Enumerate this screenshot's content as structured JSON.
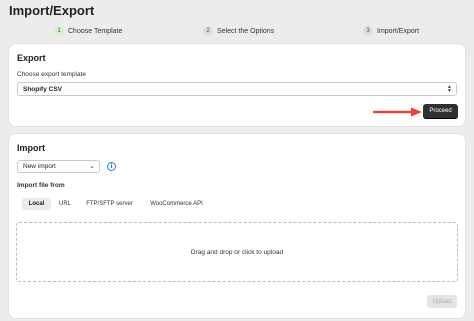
{
  "page": {
    "title": "Import/Export"
  },
  "steps": [
    {
      "num": "1",
      "label": "Choose Template"
    },
    {
      "num": "2",
      "label": "Select the Options"
    },
    {
      "num": "3",
      "label": "Import/Export"
    }
  ],
  "export": {
    "title": "Export",
    "template_label": "Choose export template",
    "template_value": "Shopify CSV",
    "proceed_label": "Proceed"
  },
  "import": {
    "title": "Import",
    "mode_value": "New import",
    "file_from_label": "Import file from",
    "tabs": [
      "Local",
      "URL",
      "FTP/SFTP server",
      "WooCommerce API"
    ],
    "dropzone_text": "Drag and drop or click to upload",
    "upload_label": "Upload"
  },
  "colors": {
    "accent_arrow": "#e2463a",
    "active_step": "#d8f0cf",
    "info": "#2f7fd6"
  }
}
